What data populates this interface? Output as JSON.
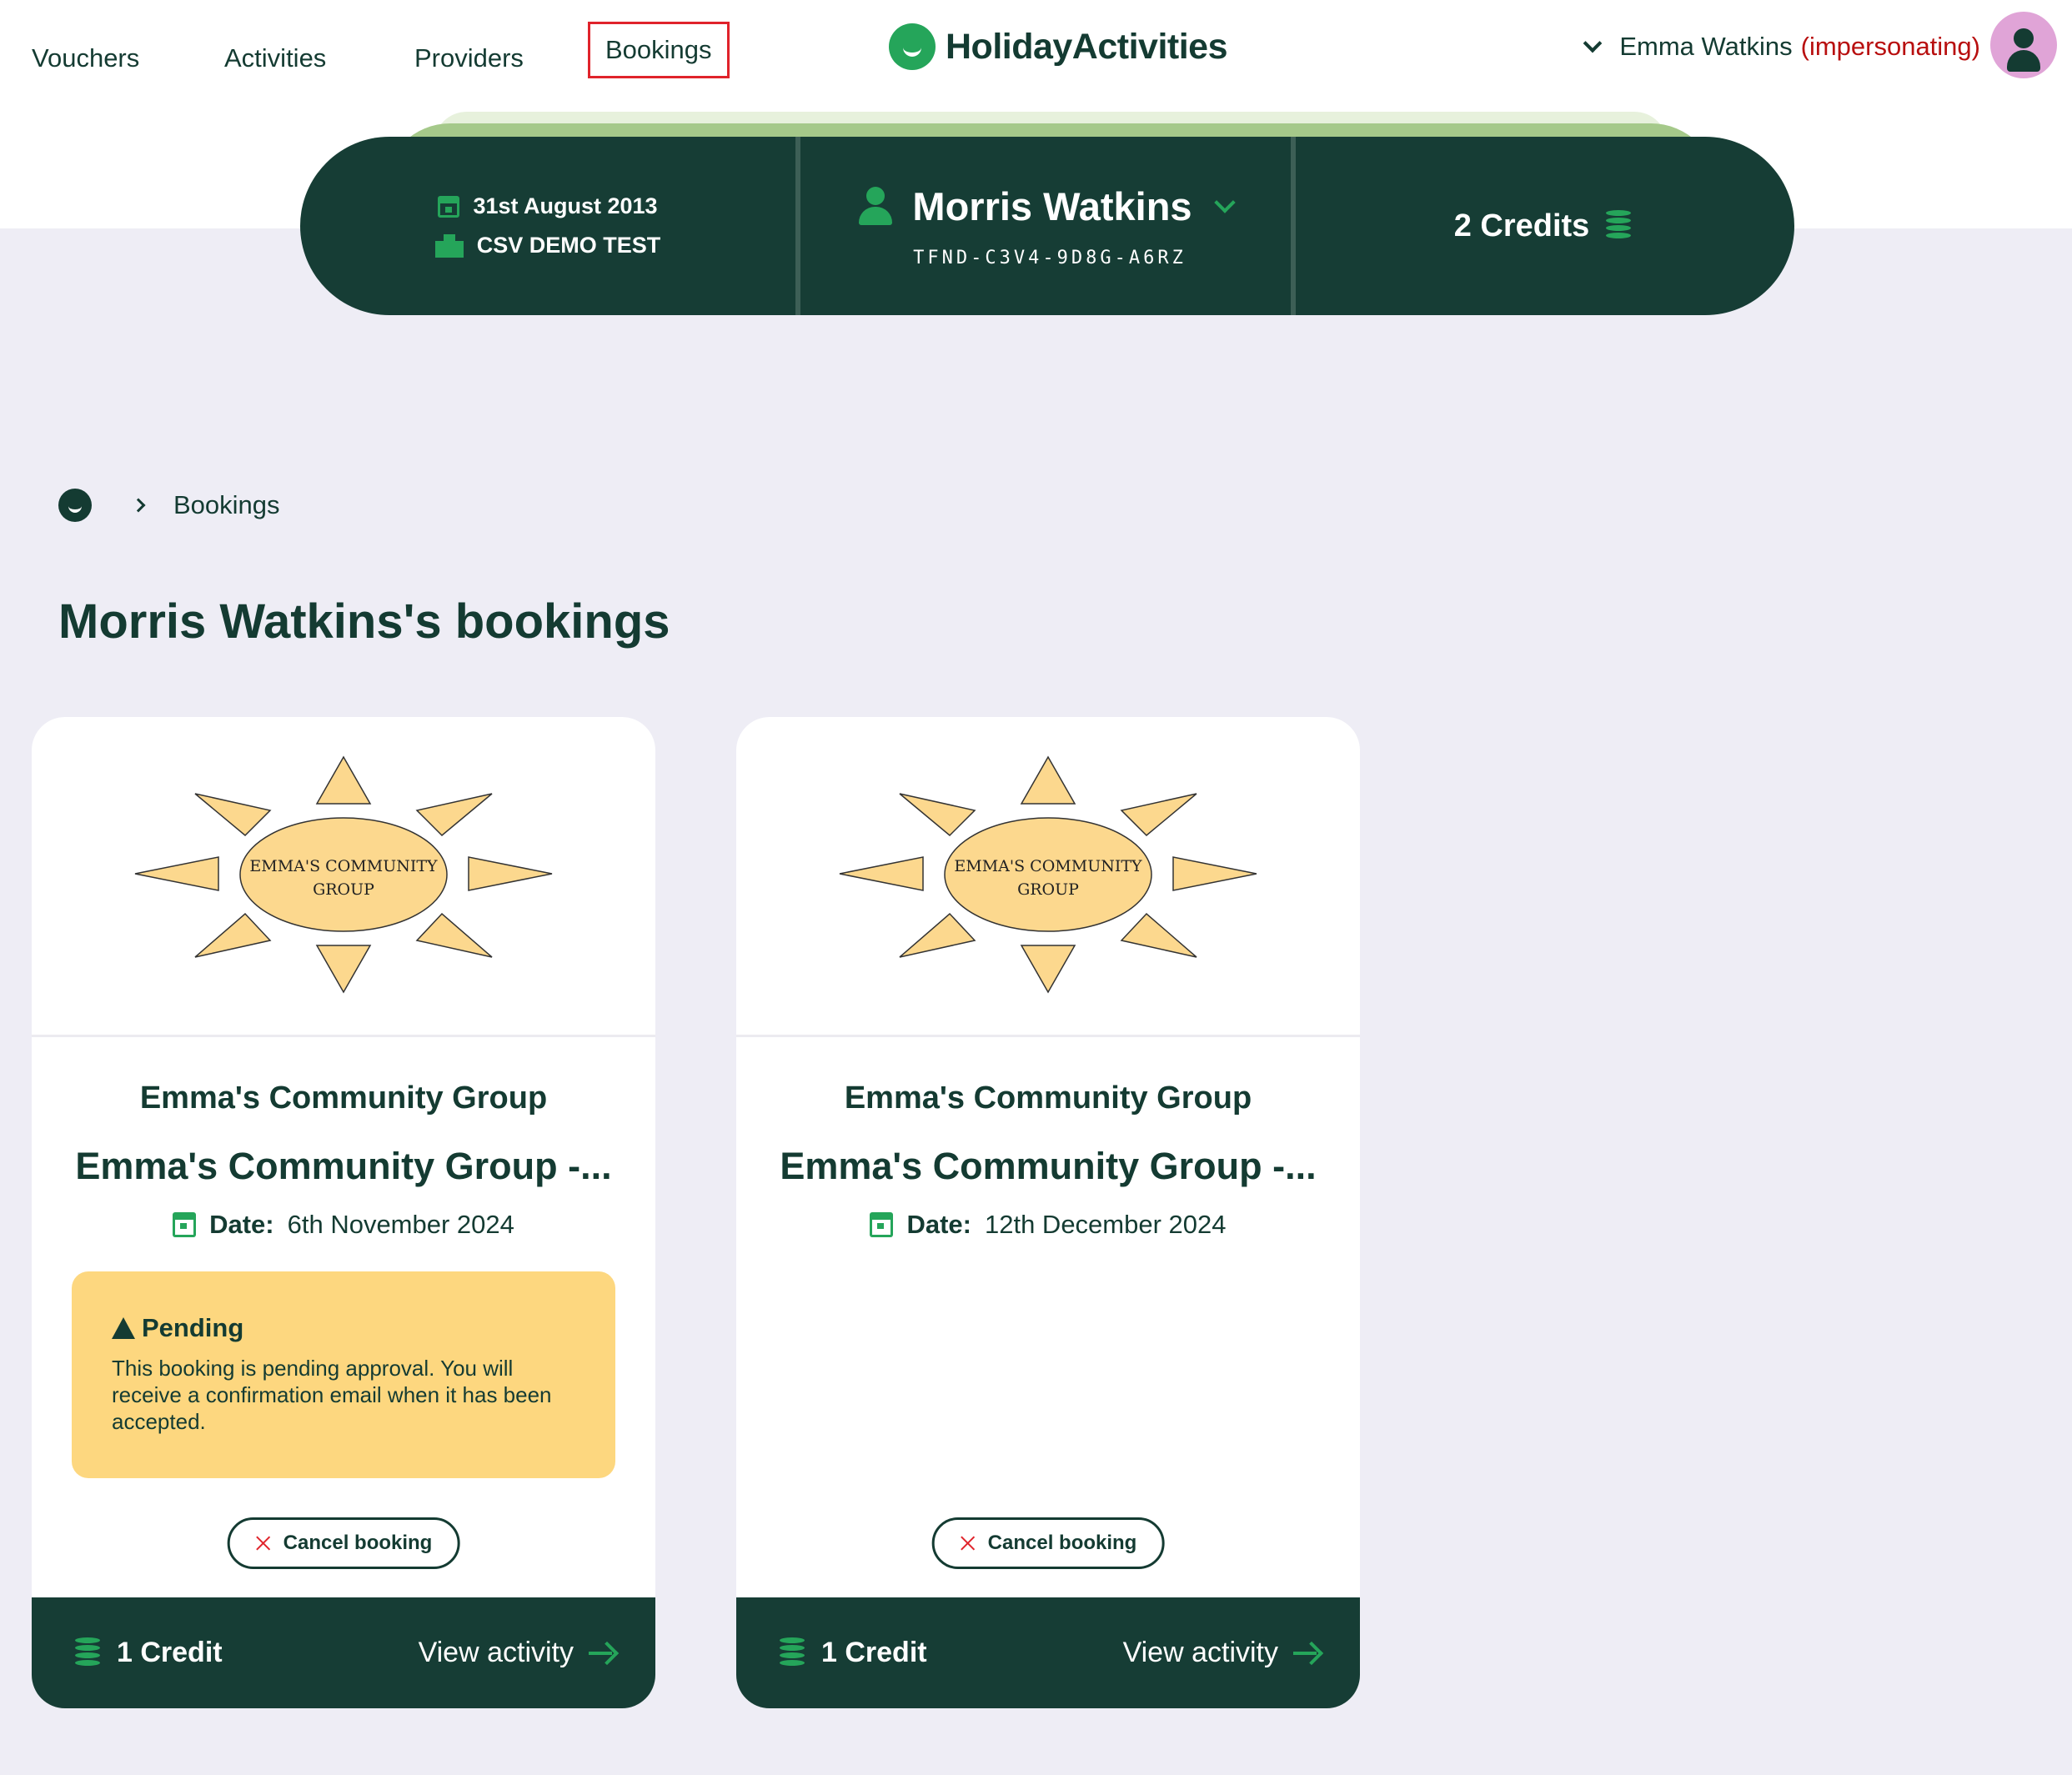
{
  "nav": {
    "items": [
      "Vouchers",
      "Activities",
      "Providers",
      "Bookings"
    ],
    "active": "Bookings"
  },
  "brand": {
    "name": "HolidayActivities"
  },
  "user": {
    "name": "Emma Watkins",
    "status": "(impersonating)"
  },
  "hero": {
    "date": "31st August 2013",
    "scheme": "CSV DEMO TEST",
    "child_name": "Morris Watkins",
    "voucher_code": "TFND-C3V4-9D8G-A6RZ",
    "credits": "2 Credits"
  },
  "breadcrumb": {
    "current": "Bookings"
  },
  "page": {
    "title": "Morris Watkins's bookings"
  },
  "bookings": [
    {
      "logo_text_1": "EMMA'S COMMUNITY",
      "logo_text_2": "GROUP",
      "provider": "Emma's Community Group",
      "title": "Emma's Community Group -...",
      "date_label": "Date:",
      "date": "6th November 2024",
      "pending_title": "Pending",
      "pending_text": "This booking is pending approval. You will receive a confirmation email when it has been accepted.",
      "cancel_label": "Cancel booking",
      "credit": "1 Credit",
      "view_label": "View activity"
    },
    {
      "logo_text_1": "EMMA'S COMMUNITY",
      "logo_text_2": "GROUP",
      "provider": "Emma's Community Group",
      "title": "Emma's Community Group -...",
      "date_label": "Date:",
      "date": "12th December 2024",
      "cancel_label": "Cancel booking",
      "credit": "1 Credit",
      "view_label": "View activity"
    }
  ],
  "colors": {
    "brand_dark": "#163d35",
    "brand_green": "#25a55a",
    "pending_bg": "#fdd77f",
    "impersonating": "#b80f0f",
    "active_nav_border": "#e0232b"
  }
}
